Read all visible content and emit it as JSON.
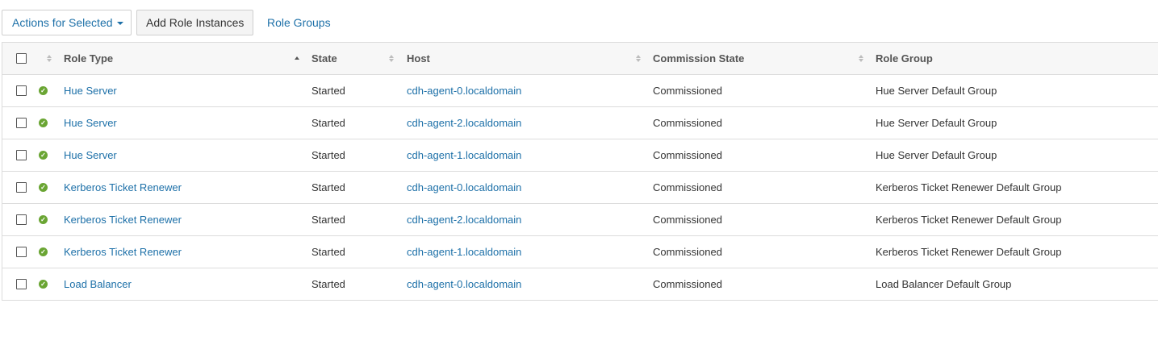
{
  "toolbar": {
    "actions_label": "Actions for Selected",
    "add_label": "Add Role Instances",
    "role_groups_label": "Role Groups"
  },
  "table": {
    "columns": {
      "role_type": "Role Type",
      "state": "State",
      "host": "Host",
      "commission_state": "Commission State",
      "role_group": "Role Group"
    },
    "rows": [
      {
        "role_type": "Hue Server",
        "state": "Started",
        "host": "cdh-agent-0.localdomain",
        "commission_state": "Commissioned",
        "role_group": "Hue Server Default Group"
      },
      {
        "role_type": "Hue Server",
        "state": "Started",
        "host": "cdh-agent-2.localdomain",
        "commission_state": "Commissioned",
        "role_group": "Hue Server Default Group"
      },
      {
        "role_type": "Hue Server",
        "state": "Started",
        "host": "cdh-agent-1.localdomain",
        "commission_state": "Commissioned",
        "role_group": "Hue Server Default Group"
      },
      {
        "role_type": "Kerberos Ticket Renewer",
        "state": "Started",
        "host": "cdh-agent-0.localdomain",
        "commission_state": "Commissioned",
        "role_group": "Kerberos Ticket Renewer Default Group"
      },
      {
        "role_type": "Kerberos Ticket Renewer",
        "state": "Started",
        "host": "cdh-agent-2.localdomain",
        "commission_state": "Commissioned",
        "role_group": "Kerberos Ticket Renewer Default Group"
      },
      {
        "role_type": "Kerberos Ticket Renewer",
        "state": "Started",
        "host": "cdh-agent-1.localdomain",
        "commission_state": "Commissioned",
        "role_group": "Kerberos Ticket Renewer Default Group"
      },
      {
        "role_type": "Load Balancer",
        "state": "Started",
        "host": "cdh-agent-0.localdomain",
        "commission_state": "Commissioned",
        "role_group": "Load Balancer Default Group"
      }
    ]
  },
  "icons": {
    "status": "check-circle-icon",
    "sort": "sort-arrows-icon",
    "dropdown": "caret-down-icon"
  },
  "colors": {
    "link": "#1d70a8",
    "status_ok": "#6aa533",
    "header_bg": "#f7f7f7",
    "border": "#dcdcdc"
  }
}
